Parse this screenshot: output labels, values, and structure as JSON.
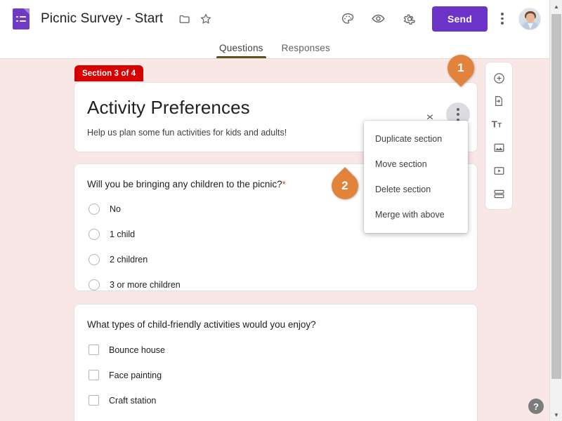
{
  "header": {
    "logo_icon": "forms-document-icon",
    "doc_title": "Picnic Survey - Start",
    "move_icon": "folder-icon",
    "star_icon": "star-icon",
    "theme_icon": "palette-icon",
    "preview_icon": "eye-icon",
    "settings_icon": "gear-icon",
    "send_label": "Send",
    "more_icon": "kebab-menu-icon",
    "avatar_icon": "user-avatar",
    "send_color": "#6c33c8"
  },
  "tabs": [
    {
      "label": "Questions",
      "active": true
    },
    {
      "label": "Responses",
      "active": false
    }
  ],
  "section": {
    "badge": "Section 3 of 4",
    "badge_color": "#d50000",
    "title": "Activity Preferences",
    "description": "Help us plan some fun activities for kids and adults!",
    "collapse_icon": "collapse-chevron-icon",
    "kebab_icon": "section-more-icon"
  },
  "questions": [
    {
      "text": "Will you be bringing any children to the picnic?",
      "required": true,
      "required_marker": "*",
      "type": "radio",
      "options": [
        "No",
        "1 child",
        "2 children",
        "3 or more children"
      ]
    },
    {
      "text": "What types of child-friendly activities would you enjoy?",
      "required": false,
      "required_marker": "",
      "type": "checkbox",
      "options": [
        "Bounce house",
        "Face painting",
        "Craft station"
      ]
    }
  ],
  "side_toolbar": [
    {
      "icon": "add-question-icon"
    },
    {
      "icon": "import-questions-icon"
    },
    {
      "icon": "add-title-icon",
      "label": "Tt"
    },
    {
      "icon": "add-image-icon"
    },
    {
      "icon": "add-video-icon"
    },
    {
      "icon": "add-section-icon"
    }
  ],
  "menu": {
    "items": [
      "Duplicate section",
      "Move section",
      "Delete section",
      "Merge with above"
    ]
  },
  "callouts": [
    {
      "number": "1"
    },
    {
      "number": "2"
    }
  ],
  "help": {
    "label": "?"
  },
  "colors": {
    "background": "#f9e7e5",
    "accent": "#e2833c"
  }
}
